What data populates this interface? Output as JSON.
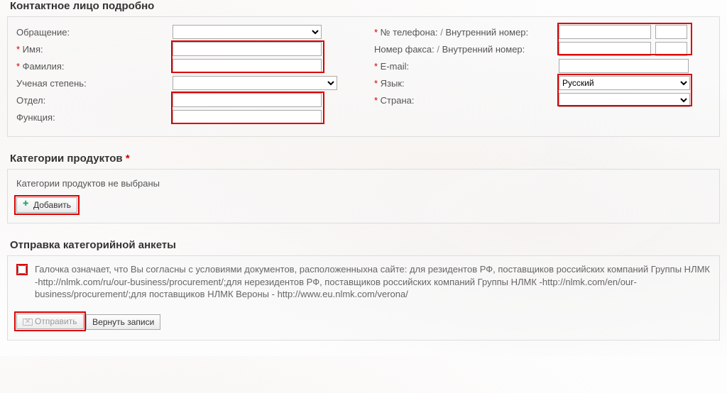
{
  "contact": {
    "title": "Контактное лицо подробно",
    "left": {
      "салютация": {
        "label": "Обращение:",
        "required": false
      },
      "firstName": {
        "label": "Имя:",
        "required": true
      },
      "lastName": {
        "label": "Фамилия:",
        "required": true
      },
      "degree": {
        "label": "Ученая степень:",
        "required": false
      },
      "department": {
        "label": "Отдел:",
        "required": false
      },
      "function": {
        "label": "Функция:",
        "required": false
      }
    },
    "right": {
      "phone": {
        "label": "№ телефона:",
        "ext": "Внутренний номер:",
        "required": true
      },
      "fax": {
        "label": "Номер факса:",
        "ext": "Внутренний номер:",
        "required": false
      },
      "email": {
        "label": "E-mail:",
        "required": true
      },
      "language": {
        "label": "Язык:",
        "required": true,
        "value": "Русский"
      },
      "country": {
        "label": "Страна:",
        "required": true
      }
    }
  },
  "categories": {
    "title": "Категории продуктов",
    "empty_msg": "Категории продуктов не выбраны",
    "add_label": "Добавить"
  },
  "submit": {
    "title": "Отправка категорийной анкеты",
    "agree_text": "Галочка означает, что Вы согласны с условиями документов, расположенныхна сайте: для резидентов РФ, поставщиков российских компаний Группы НЛМК -http://nlmk.com/ru/our-business/procurement/;для нерезидентов РФ, поставщиков российских компаний Группы НЛМК -http://nlmk.com/en/our-business/procurement/;для поставщиков НЛМК Вероны - http://www.eu.nlmk.com/verona/",
    "send_label": "Отправить",
    "reset_label": "Вернуть записи"
  }
}
